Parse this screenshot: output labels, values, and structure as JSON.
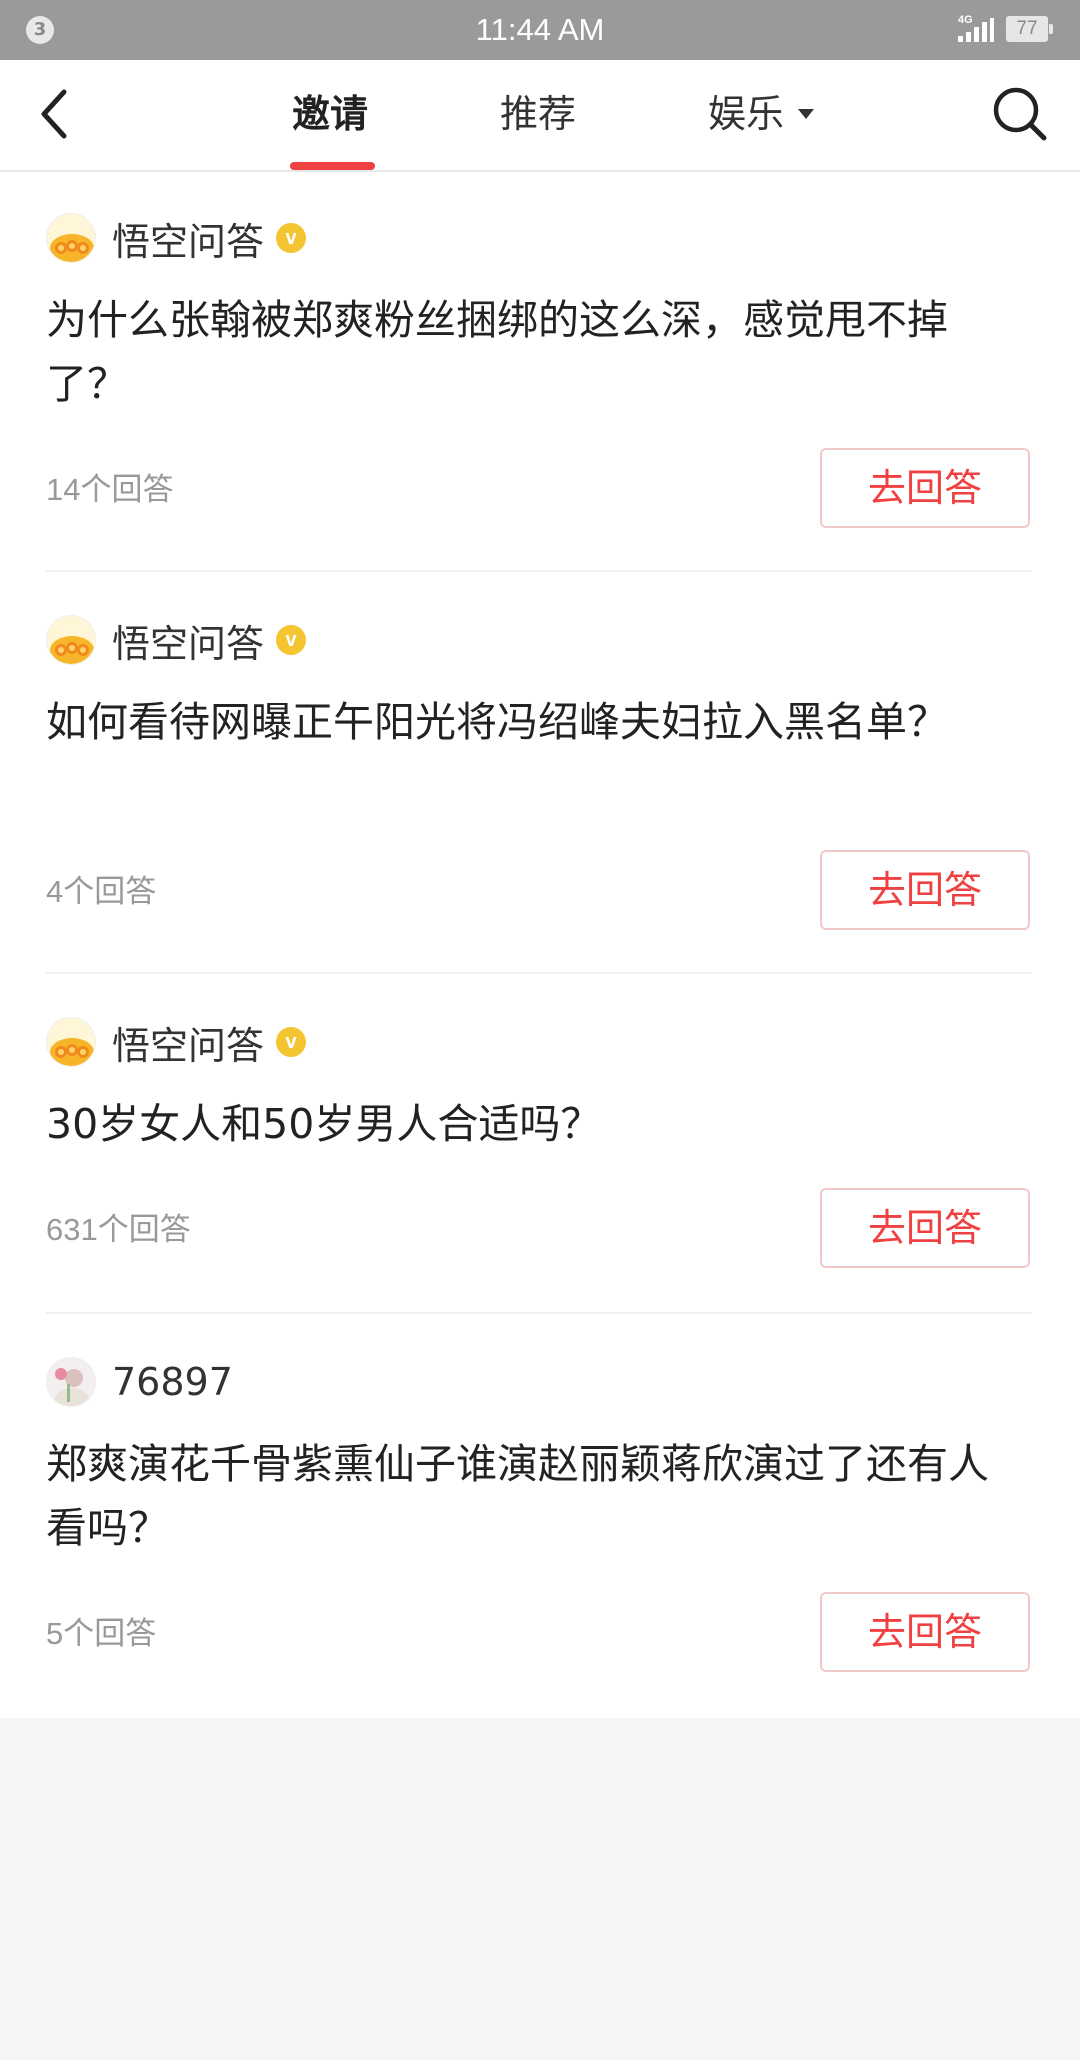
{
  "status_bar": {
    "notification_count": "3",
    "time": "11:44 AM",
    "network": "4G",
    "battery": "77"
  },
  "nav": {
    "tabs": [
      {
        "label": "邀请",
        "active": true
      },
      {
        "label": "推荐",
        "active": false
      },
      {
        "label": "娱乐",
        "active": false,
        "has_dropdown": true
      }
    ],
    "accent_color": "#f04142"
  },
  "questions": [
    {
      "author": "悟空问答",
      "verified": true,
      "avatar_icon": "wukong-avatar-icon",
      "text": "为什么张翰被郑爽粉丝捆绑的这么深，感觉甩不掉了？",
      "answer_count": "14个回答",
      "action_label": "去回答"
    },
    {
      "author": "悟空问答",
      "verified": true,
      "avatar_icon": "wukong-avatar-icon",
      "text": "如何看待网曝正午阳光将冯绍峰夫妇拉入黑名单？",
      "answer_count": "4个回答",
      "action_label": "去回答"
    },
    {
      "author": "悟空问答",
      "verified": true,
      "avatar_icon": "wukong-avatar-icon",
      "text": "30岁女人和50岁男人合适吗？",
      "answer_count": "631个回答",
      "action_label": "去回答"
    },
    {
      "author": "76897",
      "verified": false,
      "avatar_icon": "user-avatar-icon",
      "text": "郑爽演花千骨紫熏仙子谁演赵丽颖蒋欣演过了还有人看吗？",
      "answer_count": "5个回答",
      "action_label": "去回答"
    }
  ]
}
